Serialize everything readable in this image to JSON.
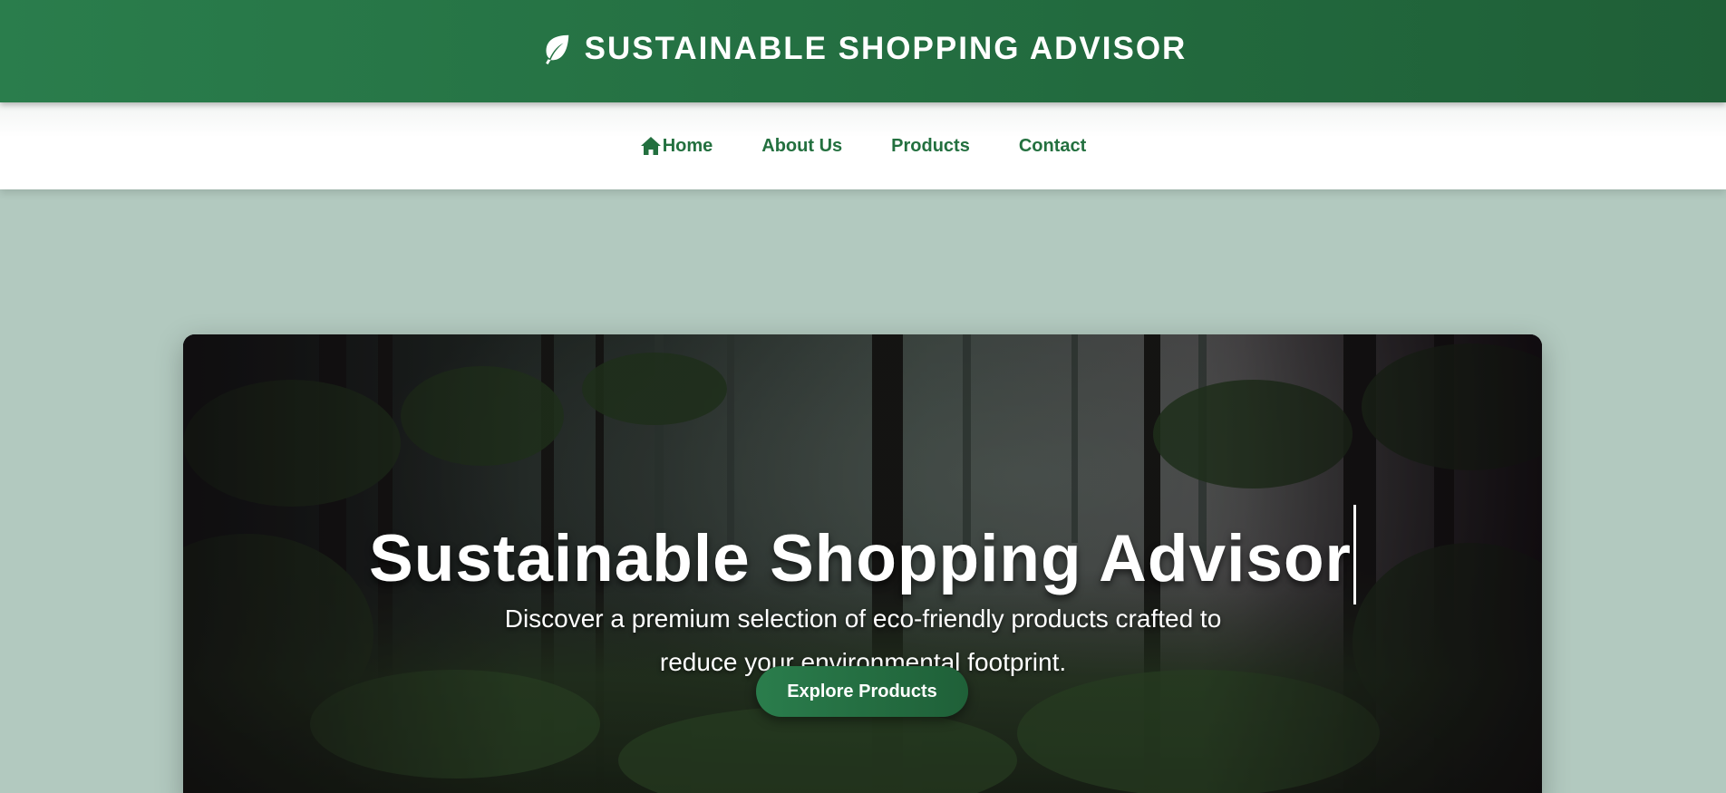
{
  "header": {
    "brand_icon": "leaf-icon",
    "title": "SUSTAINABLE SHOPPING ADVISOR",
    "background": "#2a7d4c"
  },
  "nav": {
    "items": [
      {
        "label": "Home",
        "icon": "home-icon"
      },
      {
        "label": "About Us"
      },
      {
        "label": "Products"
      },
      {
        "label": "Contact"
      }
    ],
    "link_color": "#23703f"
  },
  "hero": {
    "title": "Sustainable Shopping Advisor",
    "subtitle": "Discover a premium selection of eco-friendly products crafted to reduce your environmental footprint.",
    "button_label": "Explore Products",
    "background_image": "forest-image"
  },
  "colors": {
    "page_background": "#b2c9bf",
    "accent": "#2a7d4c"
  }
}
